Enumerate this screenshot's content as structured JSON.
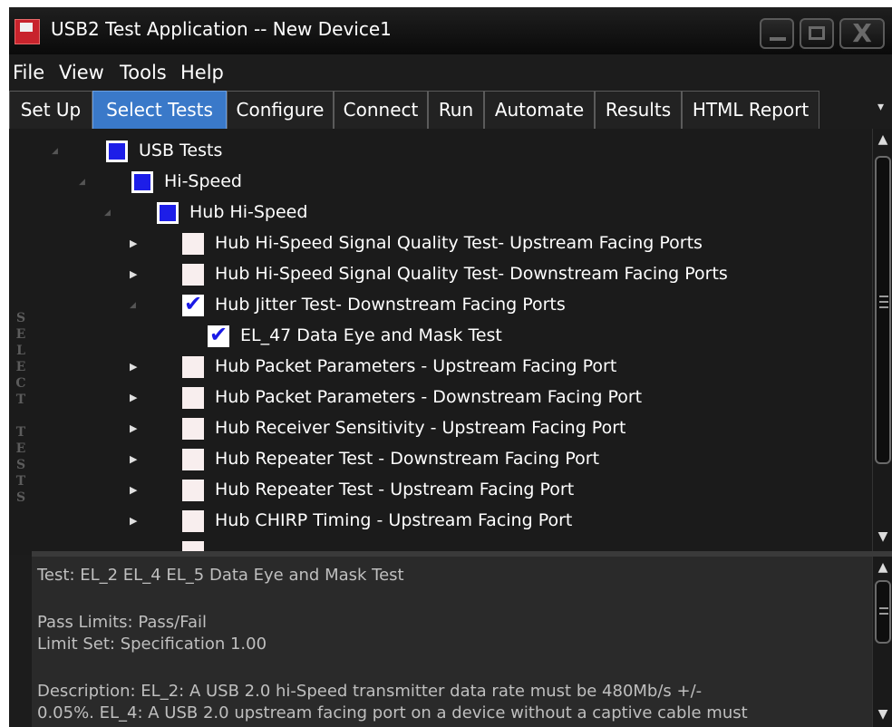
{
  "window": {
    "title": "USB2 Test Application -- New Device1"
  },
  "menu": [
    "File",
    "View",
    "Tools",
    "Help"
  ],
  "tabs": [
    {
      "label": "Set Up",
      "active": false
    },
    {
      "label": "Select Tests",
      "active": true
    },
    {
      "label": "Configure",
      "active": false
    },
    {
      "label": "Connect",
      "active": false
    },
    {
      "label": "Run",
      "active": false
    },
    {
      "label": "Automate",
      "active": false
    },
    {
      "label": "Results",
      "active": false
    },
    {
      "label": "HTML Report",
      "active": false
    }
  ],
  "side_label": "SELECT TESTS",
  "tree": [
    {
      "label": "USB Tests",
      "state": "partial",
      "level": 0,
      "expander": "expanded"
    },
    {
      "label": "Hi-Speed",
      "state": "partial",
      "level": 1,
      "expander": "expanded"
    },
    {
      "label": "Hub Hi-Speed",
      "state": "partial",
      "level": 2,
      "expander": "expanded"
    },
    {
      "label": "Hub Hi-Speed Signal Quality Test- Upstream Facing Ports",
      "state": "unchecked",
      "level": 3,
      "expander": "collapsed"
    },
    {
      "label": "Hub Hi-Speed Signal Quality Test- Downstream Facing Ports",
      "state": "unchecked",
      "level": 3,
      "expander": "collapsed"
    },
    {
      "label": "Hub Jitter Test- Downstream Facing Ports",
      "state": "checked",
      "level": 3,
      "expander": "expanded"
    },
    {
      "label": "EL_47 Data Eye and Mask Test",
      "state": "checked",
      "level": 4,
      "expander": "none"
    },
    {
      "label": "Hub Packet Parameters - Upstream Facing Port",
      "state": "unchecked",
      "level": 3,
      "expander": "collapsed"
    },
    {
      "label": "Hub Packet Parameters - Downstream Facing Port",
      "state": "unchecked",
      "level": 3,
      "expander": "collapsed"
    },
    {
      "label": "Hub Receiver Sensitivity - Upstream Facing Port",
      "state": "unchecked",
      "level": 3,
      "expander": "collapsed"
    },
    {
      "label": "Hub Repeater Test - Downstream Facing Port",
      "state": "unchecked",
      "level": 3,
      "expander": "collapsed"
    },
    {
      "label": "Hub Repeater Test - Upstream Facing Port",
      "state": "unchecked",
      "level": 3,
      "expander": "collapsed"
    },
    {
      "label": "Hub CHIRP Timing - Upstream Facing Port",
      "state": "unchecked",
      "level": 3,
      "expander": "collapsed"
    }
  ],
  "description": {
    "test": "Test: EL_2 EL_4 EL_5 Data Eye and Mask Test",
    "pass_limits": "Pass Limits: Pass/Fail",
    "limit_set": "Limit Set: Specification 1.00",
    "desc_line1": "Description: EL_2: A USB 2.0 hi-Speed transmitter data rate must be 480Mb/s +/-",
    "desc_line2": "0.05%. EL_4: A USB 2.0 upstream facing port on a device without a captive cable must"
  },
  "colors": {
    "tab_active": "#3a79c9",
    "checkbox_partial": "#1d1ee8",
    "checkmark": "#1a1ae6",
    "window_bg": "#1c1c1c",
    "app_icon": "#c8232c"
  },
  "icons": [
    "app-icon",
    "minimize-icon",
    "maximize-icon",
    "close-icon",
    "scroll-up-arrow",
    "scroll-down-arrow",
    "expand-arrow",
    "tab-overflow-arrow"
  ]
}
